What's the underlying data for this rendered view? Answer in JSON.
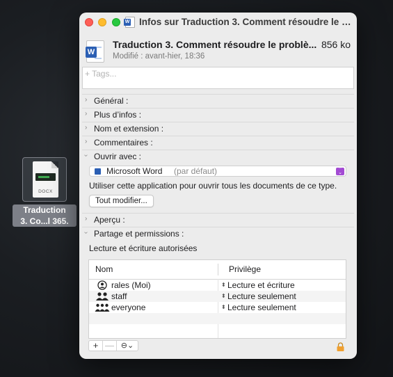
{
  "desktop": {
    "file_icon_ext": "DOCX",
    "file_label_line1": "Traduction",
    "file_label_line2": "3. Co...l 365."
  },
  "window": {
    "title": "Infos sur Traduction 3. Comment résoudre le p...",
    "file_name": "Traduction 3. Comment résoudre le problè...",
    "file_size": "856 ko",
    "modified": "Modifié : avant-hier, 18:36",
    "tags_placeholder": "+ Tags..."
  },
  "sections": {
    "general": "Général :",
    "more_info": "Plus d’infos :",
    "name_ext": "Nom et extension :",
    "comments": "Commentaires :",
    "open_with": "Ouvrir avec :",
    "preview": "Aperçu :",
    "sharing": "Partage et permissions :"
  },
  "open_with": {
    "app_name": "Microsoft Word",
    "app_default": "(par défaut)",
    "description": "Utiliser cette application pour ouvrir tous les documents de ce type.",
    "change_all_button": "Tout modifier..."
  },
  "permissions": {
    "note": "Lecture et écriture autorisées",
    "columns": [
      "Nom",
      "Privilège"
    ],
    "rows": [
      {
        "name": "rales (Moi)",
        "privilege": "Lecture et écriture",
        "icon": "person-icon"
      },
      {
        "name": "staff",
        "privilege": "Lecture seulement",
        "icon": "group-icon"
      },
      {
        "name": "everyone",
        "privilege": "Lecture seulement",
        "icon": "everyone-icon"
      }
    ],
    "toolbar": {
      "add": "+",
      "remove": "—",
      "action": "⊖⌄"
    }
  },
  "colors": {
    "accent_purple": "#a34bd3",
    "word_blue": "#2b5fb4",
    "lock_orange": "#f0a030"
  }
}
